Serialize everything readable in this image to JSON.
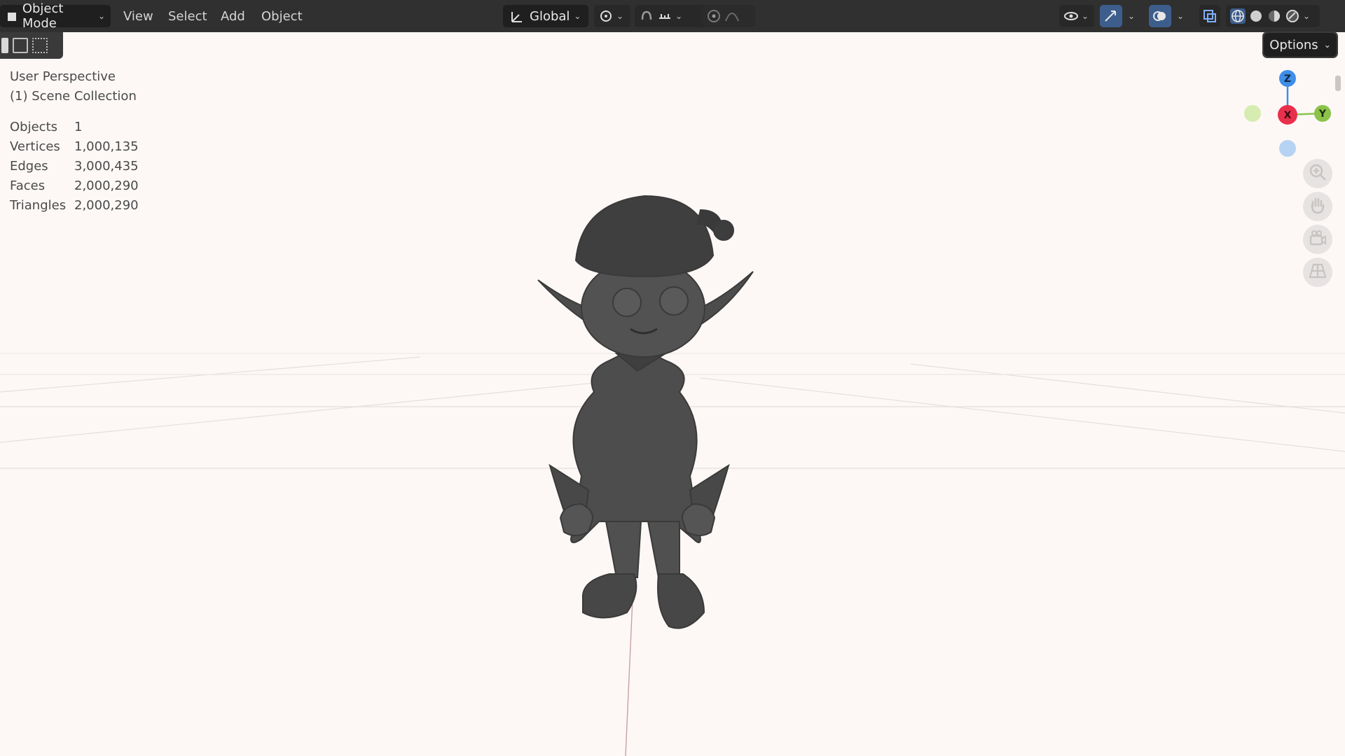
{
  "header": {
    "mode": "Object Mode",
    "menus": [
      "View",
      "Select",
      "Add",
      "Object"
    ],
    "transform_orientation": "Global",
    "options_label": "Options"
  },
  "overlay": {
    "view_name": "User Perspective",
    "collection": "(1) Scene Collection",
    "stats": [
      {
        "label": "Objects",
        "value": "1"
      },
      {
        "label": "Vertices",
        "value": "1,000,135"
      },
      {
        "label": "Edges",
        "value": "3,000,435"
      },
      {
        "label": "Faces",
        "value": "2,000,290"
      },
      {
        "label": "Triangles",
        "value": "2,000,290"
      }
    ]
  },
  "gizmo": {
    "z_label": "Z",
    "x_label": "X",
    "y_label": "Y",
    "colors": {
      "x": "#e8304c",
      "y": "#8bc34a",
      "z": "#3f8ee8",
      "x_neg": "#d7ecb0",
      "z_neg": "#b7d3f3"
    }
  },
  "icons": [
    "object-mode-icon",
    "transform-orientation-icon",
    "pivot-icon",
    "snap-icon",
    "snap-increment-icon",
    "proportional-editing-icon",
    "falloff-icon",
    "visibility-icon",
    "gizmo-toggle-icon",
    "overlay-toggle-icon",
    "xray-icon",
    "wireframe-shading-icon",
    "solid-shading-icon",
    "material-shading-icon",
    "rendered-shading-icon",
    "zoom-icon",
    "pan-hand-icon",
    "camera-icon",
    "grid-perspective-icon"
  ],
  "colors": {
    "topbar": "#303030",
    "viewport_bg": "#fdf8f6",
    "model": "#4a4a4a",
    "accent_active": "#3d5e8c"
  }
}
